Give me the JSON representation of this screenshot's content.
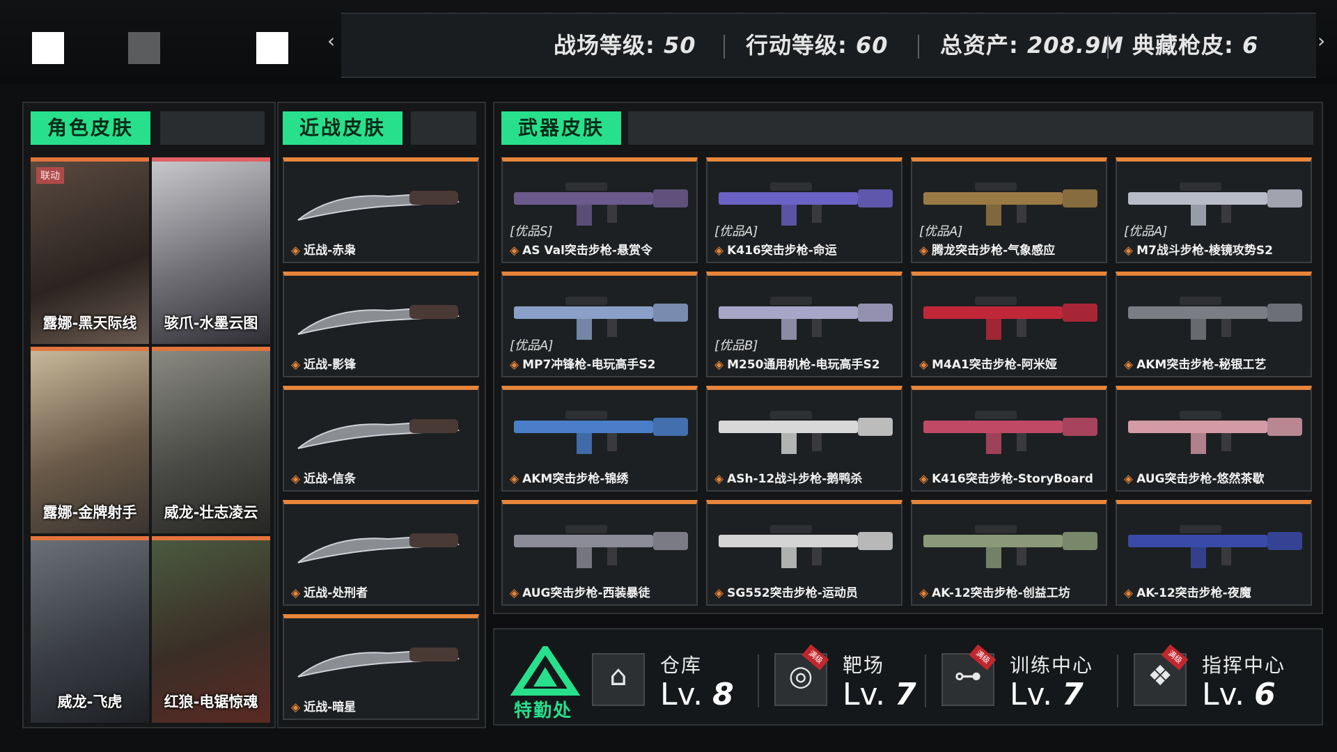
{
  "top_bar": {
    "stats": [
      {
        "label": "战场等级",
        "value": "50"
      },
      {
        "label": "行动等级",
        "value": "60"
      },
      {
        "label": "总资产",
        "value": "208.9M"
      },
      {
        "label": "典藏枪皮",
        "value": "6"
      }
    ],
    "nav_left_icon": "chevron-left-icon",
    "nav_right_icon": "chevron-right-icon"
  },
  "character_section": {
    "tab_label": "角色皮肤",
    "items": [
      {
        "name": "露娜-黑天际线",
        "tag": "联动"
      },
      {
        "name": "骇爪-水墨云图",
        "tag": ""
      },
      {
        "name": "露娜-金牌射手",
        "tag": ""
      },
      {
        "name": "威龙-壮志凌云",
        "tag": ""
      },
      {
        "name": "威龙-飞虎",
        "tag": ""
      },
      {
        "name": "红狼-电锯惊魂",
        "tag": ""
      }
    ]
  },
  "melee_section": {
    "tab_label": "近战皮肤",
    "items": [
      {
        "name": "近战-赤枭"
      },
      {
        "name": "近战-影锋"
      },
      {
        "name": "近战-信条"
      },
      {
        "name": "近战-处刑者"
      },
      {
        "name": "近战-暗星"
      }
    ]
  },
  "weapon_section": {
    "tab_label": "武器皮肤",
    "items": [
      {
        "grade": "[优品S]",
        "name": "AS Val突击步枪-悬赏令",
        "color": "#6b5a8c"
      },
      {
        "grade": "[优品A]",
        "name": "K416突击步枪-命运",
        "color": "#6a62c4"
      },
      {
        "grade": "[优品A]",
        "name": "腾龙突击步枪-气象感应",
        "color": "#9a7a44"
      },
      {
        "grade": "[优品A]",
        "name": "M7战斗步枪-棱镜攻势S2",
        "color": "#b8bcc8"
      },
      {
        "grade": "[优品A]",
        "name": "MP7冲锋枪-电玩高手S2",
        "color": "#8aa0c8"
      },
      {
        "grade": "[优品B]",
        "name": "M250通用机枪-电玩高手S2",
        "color": "#a8a6c8"
      },
      {
        "grade": "",
        "name": "M4A1突击步枪-阿米娅",
        "color": "#c0283a"
      },
      {
        "grade": "",
        "name": "AKM突击步枪-秘银工艺",
        "color": "#7a7e84"
      },
      {
        "grade": "",
        "name": "AKM突击步枪-锦绣",
        "color": "#4a7ec8"
      },
      {
        "grade": "",
        "name": "ASh-12战斗步枪-鹅鸭杀",
        "color": "#d8d8d8"
      },
      {
        "grade": "",
        "name": "K416突击步枪-StoryBoard",
        "color": "#c04a66"
      },
      {
        "grade": "",
        "name": "AUG突击步枪-悠然茶歇",
        "color": "#d49aa6"
      },
      {
        "grade": "",
        "name": "AUG突击步枪-西装暴徒",
        "color": "#8c8c98"
      },
      {
        "grade": "",
        "name": "SG552突击步枪-运动员",
        "color": "#d4d4d4"
      },
      {
        "grade": "",
        "name": "AK-12突击步枪-创益工坊",
        "color": "#8a9a78"
      },
      {
        "grade": "",
        "name": "AK-12突击步枪-夜魔",
        "color": "#3a4aa8"
      }
    ]
  },
  "facility_bar": {
    "logo_label": "特勤处",
    "facilities": [
      {
        "name": "仓库",
        "level": "8",
        "lv_prefix": "Lv.",
        "icon": "warehouse-icon",
        "badge": ""
      },
      {
        "name": "靶场",
        "level": "7",
        "lv_prefix": "Lv.",
        "icon": "target-icon",
        "badge": "满级"
      },
      {
        "name": "训练中心",
        "level": "7",
        "lv_prefix": "Lv.",
        "icon": "dumbbell-icon",
        "badge": "满级"
      },
      {
        "name": "指挥中心",
        "level": "6",
        "lv_prefix": "Lv.",
        "icon": "command-icon",
        "badge": "满级"
      }
    ]
  },
  "colors": {
    "accent_green": "#28e08c",
    "accent_orange": "#e7853a",
    "panel_bg": "#141617"
  }
}
